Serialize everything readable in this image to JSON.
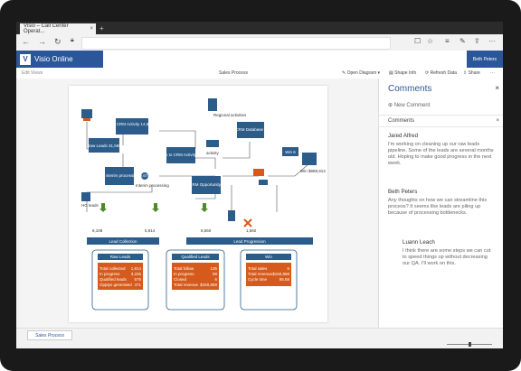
{
  "browser": {
    "tab_title": "Visio – Call Center Operat...",
    "tab_close": "×",
    "new_tab": "+",
    "icons": [
      "back-icon",
      "forward-icon",
      "refresh-icon",
      "lock-icon",
      "reader-icon",
      "favorite-icon",
      "hub-icon",
      "notes-icon",
      "share-icon",
      "more-icon"
    ]
  },
  "app": {
    "brand": "Visio Online",
    "brand_letter": "V",
    "user": "Beth Peters",
    "edit_label": "Edit Views",
    "doc_title": "Sales Process",
    "commands": [
      "Open Diagram",
      "Shape Info",
      "Refresh Data",
      "Share",
      "···"
    ]
  },
  "diagram": {
    "boxes": [
      "To CRM Activity 14,826",
      "Raw Leads 31,598",
      "Leads to CRM Activity 3,5k",
      "Leads to interim processing 9,674",
      "To CRM Database 158",
      "Win 6",
      "To CRM Opportunity 471"
    ],
    "labels": [
      "Regional activities",
      "activity",
      "Interim processing",
      "HG leads",
      "Win $988,913"
    ],
    "counts": [
      "8,108",
      "5,914",
      "8,560",
      "1,560"
    ],
    "sections": [
      "Lead Collection",
      "Lead Progression"
    ],
    "cards": [
      {
        "title": "Raw Leads",
        "rows": [
          [
            "Total collected",
            "1,914"
          ],
          [
            "In progress",
            "3,226"
          ],
          [
            "Qualified leads",
            "575"
          ],
          [
            "Opptys generated",
            "471"
          ]
        ]
      },
      {
        "title": "Qualified Leads",
        "rows": [
          [
            "Total follow",
            "135"
          ],
          [
            "In progress",
            "98"
          ],
          [
            "Closed",
            "6"
          ],
          [
            "Total revenue",
            "$150,858"
          ]
        ]
      },
      {
        "title": "Win",
        "rows": [
          [
            "Total sales",
            "6"
          ],
          [
            "Total revenue",
            "$150,858"
          ],
          [
            "Cycle time",
            "86.58"
          ]
        ]
      }
    ]
  },
  "comments_pane": {
    "title": "Comments",
    "close": "×",
    "new_comment": "New Comment",
    "section": "Comments",
    "items": [
      {
        "author": "Jared Alfred",
        "text": "I'm working on cleaning up our raw leads pipeline. Some of the leads are several months old. Hoping to make good progress in the next week."
      },
      {
        "author": "Beth Peters",
        "text": "Any thoughts on how we can streamline this process? It seems like leads are piling up because of processing bottlenecks."
      },
      {
        "author": "Luann Leach",
        "text": "I think there are some steps we can cut to speed things up without decreasing our QA. I'll work on this."
      }
    ]
  },
  "status": {
    "page_tab": "Sales Process"
  },
  "colors": {
    "brand": "#2b579a",
    "box": "#2b5c8a",
    "orange": "#d55a1b",
    "green": "#4c8a2b"
  }
}
